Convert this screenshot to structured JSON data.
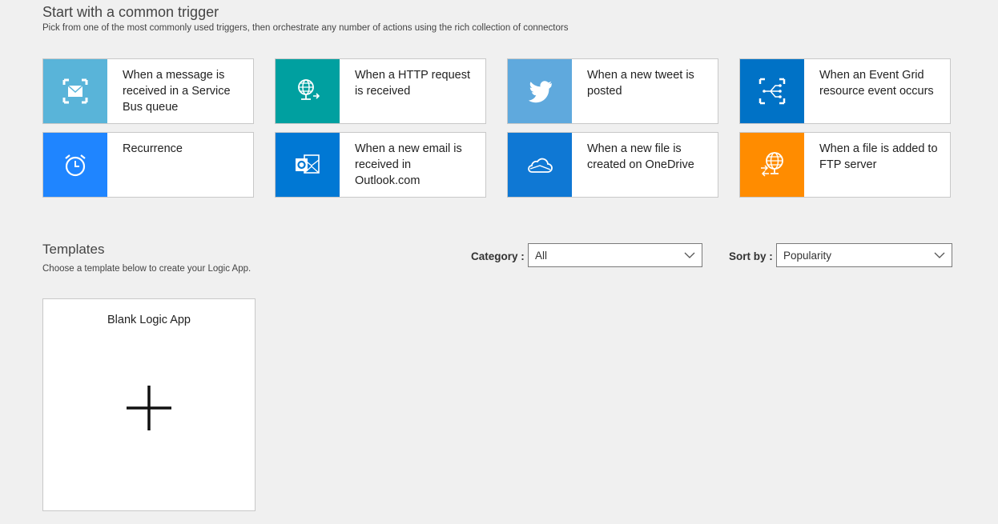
{
  "common": {
    "title": "Start with a common trigger",
    "subtitle": "Pick from one of the most commonly used triggers, then orchestrate any number of actions using the rich collection of connectors"
  },
  "triggers": [
    {
      "label": "When a message is received in a Service Bus queue",
      "icon": "service-bus-icon",
      "color": "#59b4d9"
    },
    {
      "label": "When a HTTP request is received",
      "icon": "http-request-icon",
      "color": "#00a0a0"
    },
    {
      "label": "When a new tweet is posted",
      "icon": "twitter-icon",
      "color": "#5fa9dd"
    },
    {
      "label": "When an Event Grid resource event occurs",
      "icon": "event-grid-icon",
      "color": "#0072c6"
    },
    {
      "label": "Recurrence",
      "icon": "alarm-clock-icon",
      "color": "#1f85ff"
    },
    {
      "label": "When a new email is received in Outlook.com",
      "icon": "outlook-icon",
      "color": "#0078d4"
    },
    {
      "label": "When a new file is created on OneDrive",
      "icon": "onedrive-cloud-icon",
      "color": "#0f78d4"
    },
    {
      "label": "When a file is added to FTP server",
      "icon": "ftp-globe-icon",
      "color": "#ff8c00"
    }
  ],
  "templates": {
    "title": "Templates",
    "subtitle": "Choose a template below to create your Logic App.",
    "category_label": "Category :",
    "category_value": "All",
    "sort_label": "Sort by :",
    "sort_value": "Popularity",
    "blank_card_title": "Blank Logic App"
  }
}
